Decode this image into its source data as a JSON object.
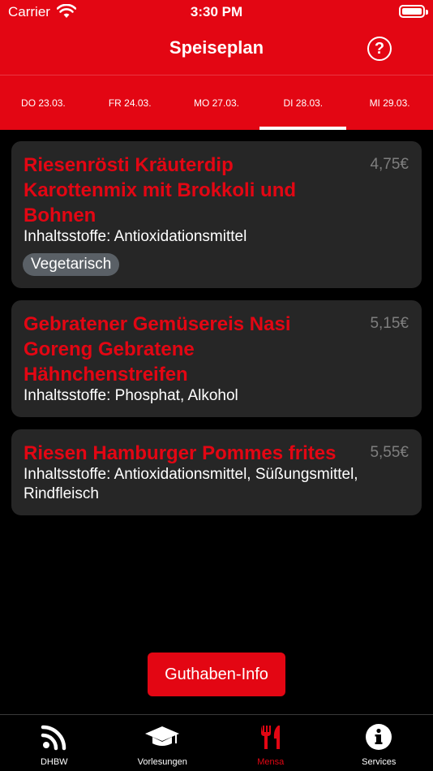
{
  "status_bar": {
    "carrier": "Carrier",
    "time": "3:30 PM"
  },
  "header": {
    "title": "Speiseplan",
    "help_glyph": "?"
  },
  "day_tabs": [
    {
      "label": "DO 23.03.",
      "active": false
    },
    {
      "label": "FR 24.03.",
      "active": false
    },
    {
      "label": "MO 27.03.",
      "active": false
    },
    {
      "label": "DI 28.03.",
      "active": true
    },
    {
      "label": "MI 29.03.",
      "active": false
    }
  ],
  "meals": [
    {
      "name": "Riesenrösti Kräuterdip Karottenmix mit Brokkoli und Bohnen",
      "price": "4,75€",
      "ingredients": "Inhaltsstoffe:  Antioxidationsmittel",
      "badge": "Vegetarisch"
    },
    {
      "name": "Gebratener Gemüsereis Nasi Goreng Gebratene Hähnchenstreifen",
      "price": "5,15€",
      "ingredients": "Inhaltsstoffe:  Phosphat, Alkohol"
    },
    {
      "name": "Riesen Hamburger Pommes frites",
      "price": "5,55€",
      "ingredients": "Inhaltsstoffe:  Antioxidationsmittel, Süßungsmittel, Rindfleisch"
    }
  ],
  "guthaben_button": "Guthaben-Info",
  "tabbar": [
    {
      "label": "DHBW",
      "icon": "rss-icon",
      "active": false
    },
    {
      "label": "Vorlesungen",
      "icon": "graduation-cap-icon",
      "active": false
    },
    {
      "label": "Mensa",
      "icon": "fork-knife-icon",
      "active": true
    },
    {
      "label": "Services",
      "icon": "info-icon",
      "active": false
    }
  ],
  "colors": {
    "accent": "#e30613",
    "card": "#262626",
    "background": "#000000",
    "badge": "#5a6066",
    "price": "#7e7e7e"
  }
}
